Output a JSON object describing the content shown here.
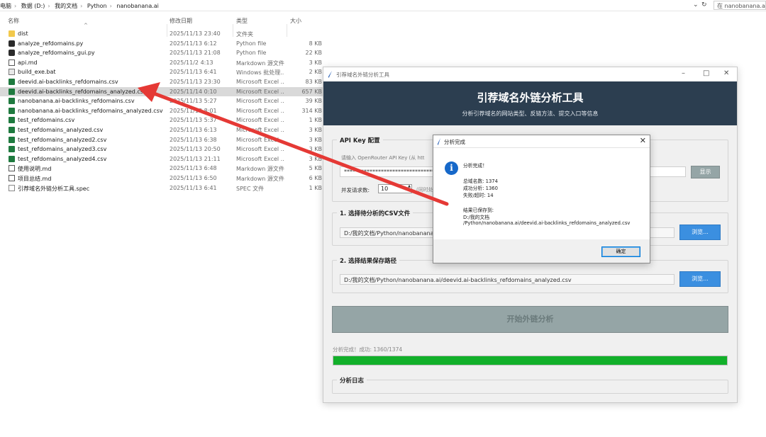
{
  "explorer": {
    "breadcrumbs": [
      "电脑",
      "数据 (D:)",
      "我的文档",
      "Python",
      "nanobanana.ai"
    ],
    "refresh_icon": "refresh-icon",
    "search_placeholder": "在 nanobanana.ai 中",
    "columns": {
      "name": "名称",
      "date": "修改日期",
      "type": "类型",
      "size": "大小"
    },
    "files": [
      {
        "name": "dist",
        "date": "2025/11/13 23:40",
        "type": "文件夹",
        "size": "",
        "icon": "folder-icon"
      },
      {
        "name": "analyze_refdomains.py",
        "date": "2025/11/13 6:12",
        "type": "Python file",
        "size": "8 KB",
        "icon": "python-file-icon"
      },
      {
        "name": "analyze_refdomains_gui.py",
        "date": "2025/11/13 21:08",
        "type": "Python file",
        "size": "22 KB",
        "icon": "python-file-icon"
      },
      {
        "name": "api.md",
        "date": "2025/11/2 4:13",
        "type": "Markdown 源文件",
        "size": "3 KB",
        "icon": "markdown-file-icon"
      },
      {
        "name": "build_exe.bat",
        "date": "2025/11/13 6:41",
        "type": "Windows 批处理...",
        "size": "2 KB",
        "icon": "batch-file-icon"
      },
      {
        "name": "deevid.ai-backlinks_refdomains.csv",
        "date": "2025/11/13 23:30",
        "type": "Microsoft Excel ...",
        "size": "83 KB",
        "icon": "csv-file-icon"
      },
      {
        "name": "deevid.ai-backlinks_refdomains_analyzed.csv",
        "date": "2025/11/14 0:10",
        "type": "Microsoft Excel ...",
        "size": "657 KB",
        "icon": "csv-file-icon",
        "selected": true
      },
      {
        "name": "nanobanana.ai-backlinks_refdomains.csv",
        "date": "2025/11/13 5:27",
        "type": "Microsoft Excel ...",
        "size": "39 KB",
        "icon": "csv-file-icon"
      },
      {
        "name": "nanobanana.ai-backlinks_refdomains_analyzed.csv",
        "date": "2025/11/13 8:01",
        "type": "Microsoft Excel ...",
        "size": "314 KB",
        "icon": "csv-file-icon"
      },
      {
        "name": "test_refdomains.csv",
        "date": "2025/11/13 5:37",
        "type": "Microsoft Excel ...",
        "size": "1 KB",
        "icon": "csv-file-icon"
      },
      {
        "name": "test_refdomains_analyzed.csv",
        "date": "2025/11/13 6:13",
        "type": "Microsoft Excel ...",
        "size": "3 KB",
        "icon": "csv-file-icon"
      },
      {
        "name": "test_refdomains_analyzed2.csv",
        "date": "2025/11/13 6:38",
        "type": "Microsoft Excel ...",
        "size": "3 KB",
        "icon": "csv-file-icon"
      },
      {
        "name": "test_refdomains_analyzed3.csv",
        "date": "2025/11/13 20:50",
        "type": "Microsoft Excel ...",
        "size": "3 KB",
        "icon": "csv-file-icon"
      },
      {
        "name": "test_refdomains_analyzed4.csv",
        "date": "2025/11/13 21:11",
        "type": "Microsoft Excel ...",
        "size": "3 KB",
        "icon": "csv-file-icon"
      },
      {
        "name": "使用说明.md",
        "date": "2025/11/13 6:48",
        "type": "Markdown 源文件",
        "size": "5 KB",
        "icon": "markdown-file-icon"
      },
      {
        "name": "项目总结.md",
        "date": "2025/11/13 6:50",
        "type": "Markdown 源文件",
        "size": "6 KB",
        "icon": "markdown-file-icon"
      },
      {
        "name": "引荐域名外链分析工具.spec",
        "date": "2025/11/13 6:41",
        "type": "SPEC 文件",
        "size": "1 KB",
        "icon": "spec-file-icon"
      }
    ]
  },
  "app": {
    "window_title": "引荐域名外链分析工具",
    "header_title": "引荐域名外链分析工具",
    "header_subtitle": "分析引荐域名的网站类型、反链方法、提交入口等信息",
    "api_group_title": "API Key 配置",
    "api_hint": "请输入 OpenRouter API Key (从 htt",
    "api_key_masked": "********************************",
    "show_button": "显示",
    "concurrency_label": "并发请求数:",
    "concurrency_value": "10",
    "concurrency_hint": "(同时处",
    "csv_group_title": "1. 选择待分析的CSV文件",
    "csv_path": "D:/我的文档/Python/nanobanana",
    "browse_button": "浏览...",
    "save_group_title": "2. 选择结果保存路径",
    "save_path": "D:/我的文档/Python/nanobanana.ai/deevid.ai-backlinks_refdomains_analyzed.csv",
    "start_button": "开始外链分析",
    "status_text": "分析完成！成功: 1360/1374",
    "progress": 1.0,
    "log_group_title": "分析日志",
    "progress_color": "#12b02a",
    "header_color": "#2c3e50",
    "accent_color": "#3b8fe0"
  },
  "dialog": {
    "title": "分析完成",
    "lines": [
      "分析完成！",
      "",
      "总域名数: 1374",
      "成功分析: 1360",
      "失败/超时: 14",
      "",
      "结果已保存到:",
      "D:/我的文档",
      "/Python/nanobanana.ai/deevid.ai-backlinks_refdomains_analyzed.csv"
    ],
    "ok_button": "确定"
  }
}
